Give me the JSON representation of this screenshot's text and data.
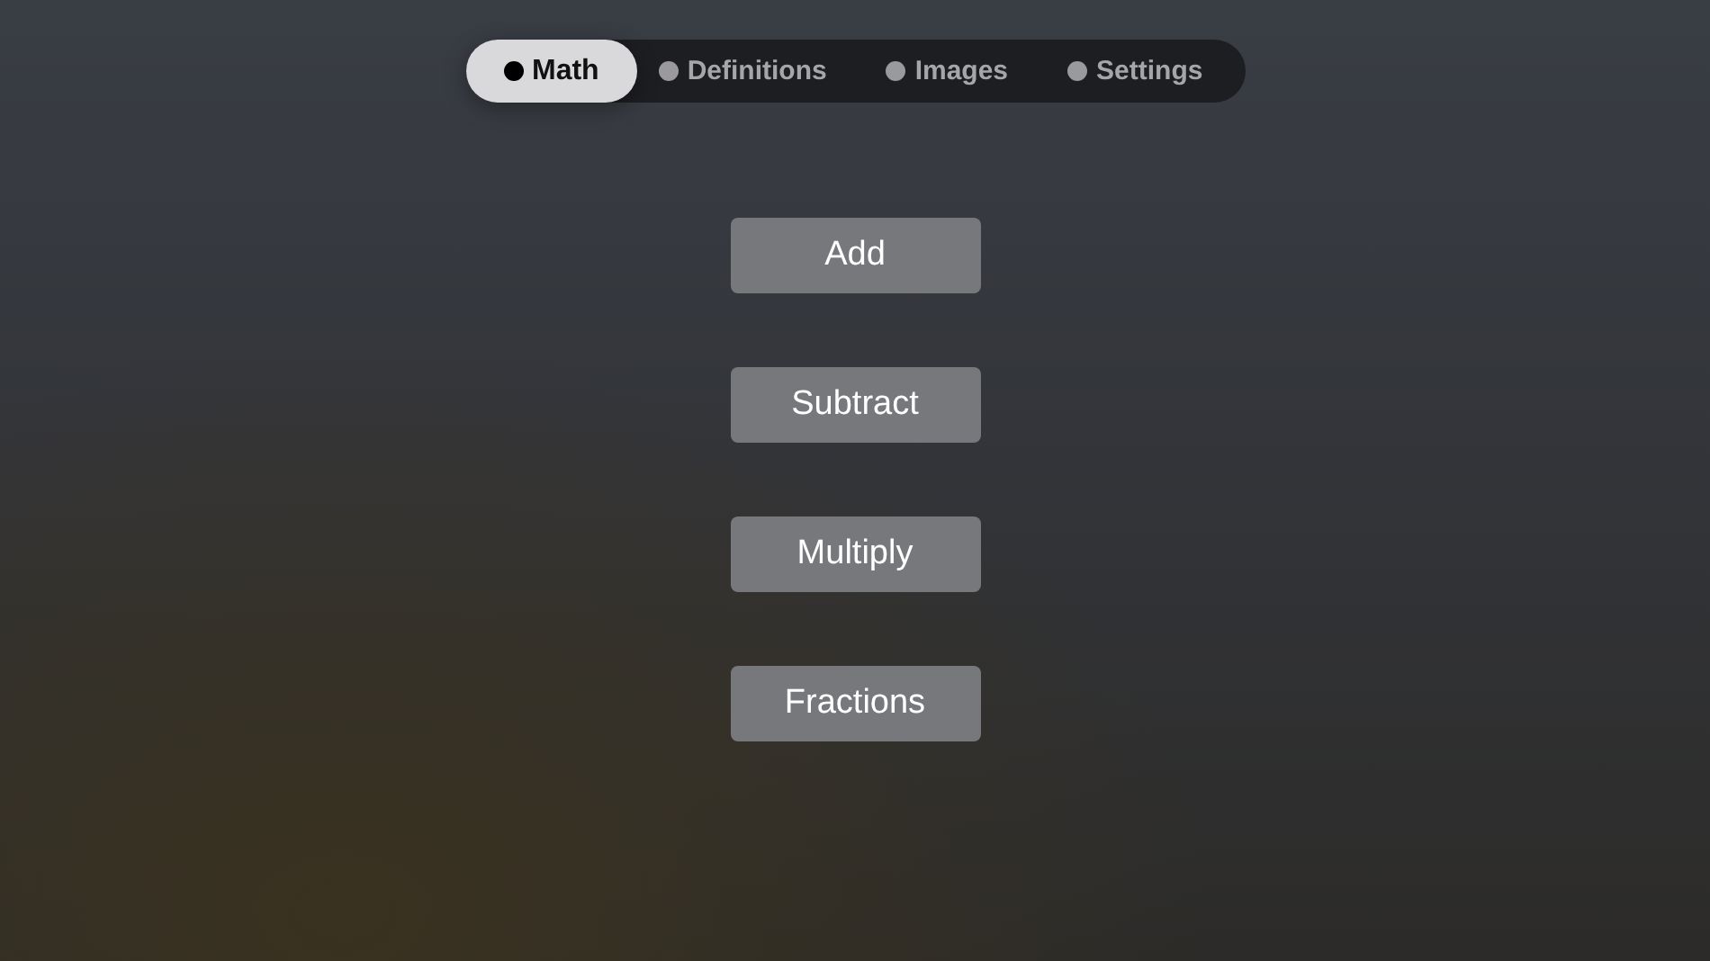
{
  "tabs": [
    {
      "label": "Math",
      "selected": true
    },
    {
      "label": "Definitions",
      "selected": false
    },
    {
      "label": "Images",
      "selected": false
    },
    {
      "label": "Settings",
      "selected": false
    }
  ],
  "buttons": [
    "Add",
    "Subtract",
    "Multiply",
    "Fractions"
  ]
}
